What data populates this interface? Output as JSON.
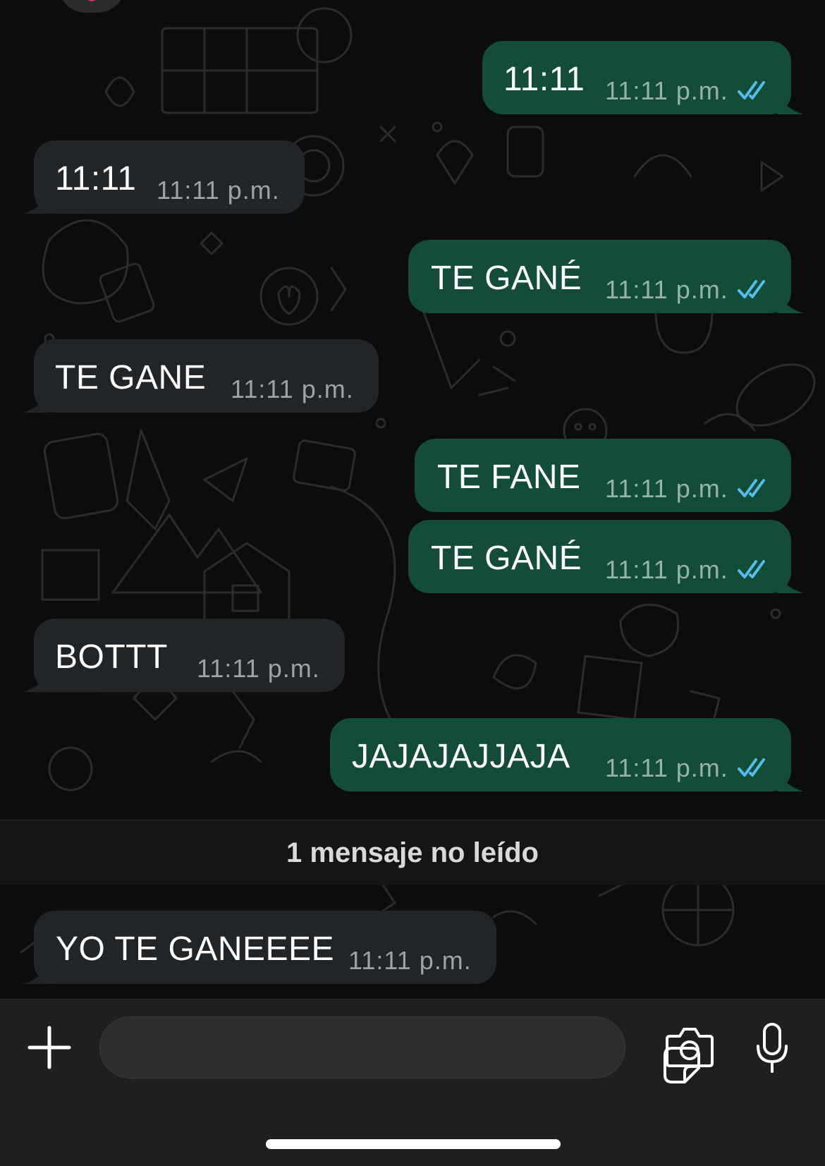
{
  "messages": [
    {
      "dir": "out",
      "text": "11:11",
      "time": "11:11 p.m.",
      "status": "read"
    },
    {
      "dir": "in",
      "text": "11:11",
      "time": "11:11 p.m."
    },
    {
      "dir": "out",
      "text": "TE GANÉ",
      "time": "11:11 p.m.",
      "status": "read"
    },
    {
      "dir": "in",
      "text": "TE GANE",
      "time": "11:11 p.m."
    },
    {
      "dir": "out",
      "text": "TE FANE",
      "time": "11:11 p.m.",
      "status": "read"
    },
    {
      "dir": "out",
      "text": "TE GANÉ",
      "time": "11:11 p.m.",
      "status": "read"
    },
    {
      "dir": "in",
      "text": "BOTTT",
      "time": "11:11 p.m."
    },
    {
      "dir": "out",
      "text": "JAJAJAJJAJA",
      "time": "11:11 p.m.",
      "status": "read"
    },
    {
      "dir": "in",
      "text": "YO TE GANEEEE",
      "time": "11:11 p.m."
    }
  ],
  "unread_banner": "1 mensaje no leído",
  "composer": {
    "placeholder": "",
    "value": "",
    "icons": [
      "plus-icon",
      "sticker-icon",
      "camera-icon",
      "microphone-icon"
    ]
  },
  "colors": {
    "outgoing_bubble": "#144d37",
    "incoming_bubble": "#222528",
    "read_ticks": "#53bdeb",
    "background": "#0c0c0c"
  }
}
